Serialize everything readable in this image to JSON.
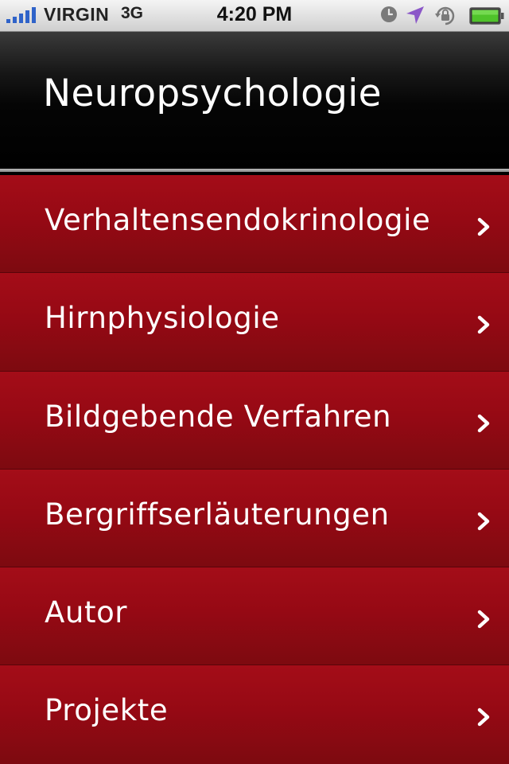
{
  "status_bar": {
    "carrier": "VIRGIN",
    "network": "3G",
    "time": "4:20 PM",
    "icons": [
      "signal-icon",
      "alarm-icon",
      "location-arrow-icon",
      "orientation-lock-icon",
      "battery-icon"
    ],
    "colors": {
      "location": "#8b57c8",
      "battery": "#4fc32a"
    }
  },
  "nav": {
    "title": "Neuropsychologie"
  },
  "menu": {
    "items": [
      {
        "label": "Verhaltensendokrinologie"
      },
      {
        "label": "Hirnphysiologie"
      },
      {
        "label": "Bildgebende Verfahren"
      },
      {
        "label": "Bergriffserläuterungen"
      },
      {
        "label": "Autor"
      },
      {
        "label": "Projekte"
      }
    ],
    "chevron_icon": "chevron-right-icon",
    "color": "#960914"
  }
}
